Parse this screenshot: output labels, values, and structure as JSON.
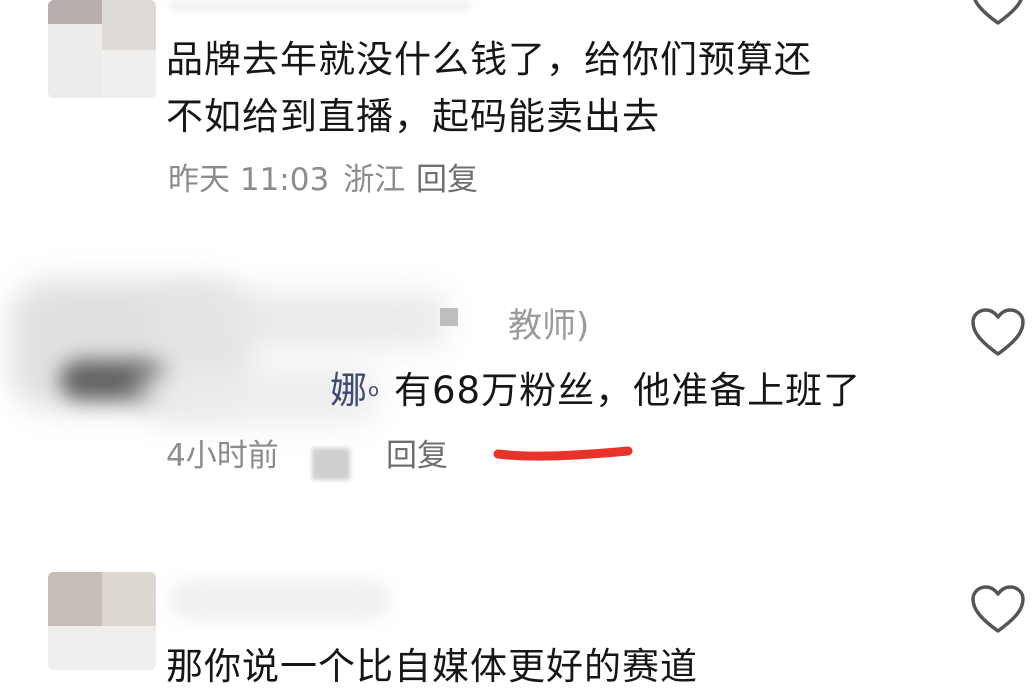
{
  "comments": [
    {
      "text_lines": [
        "品牌去年就没什么钱了，给你们预算还",
        "不如给到直播，起码能卖出去"
      ],
      "time": "昨天 11:03",
      "location": "浙江",
      "reply_label": "回复"
    },
    {
      "username_visible": "教师)",
      "mention": "娜",
      "text": "有68万粉丝，他准备上班了",
      "time": "4小时前",
      "reply_label": "回复",
      "underline_color": "#e8322a"
    },
    {
      "text_lines": [
        "那你说一个比自媒体更好的赛道"
      ]
    }
  ],
  "icons": {
    "like": "heart-outline-icon"
  },
  "colors": {
    "text": "#161616",
    "meta": "#8c8c8c",
    "heart_stroke": "#555555",
    "underline": "#e8322a"
  }
}
